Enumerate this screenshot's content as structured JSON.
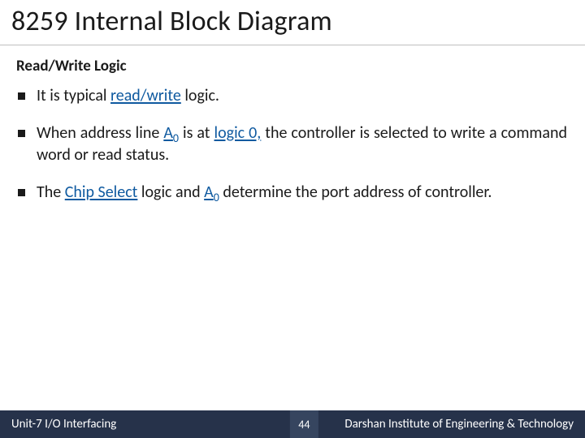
{
  "title": "8259 Internal Block Diagram",
  "subtitle": "Read/Write Logic",
  "bullets": [
    {
      "pre": "It is typical ",
      "link": "read/write",
      "post": " logic."
    },
    {
      "pre": "When address line ",
      "link": "A",
      "linksub": "0",
      "mid": " is at ",
      "link2": "logic 0,",
      "post2": " the controller is selected to write a command word or read status."
    },
    {
      "pre": "The ",
      "link": "Chip Select",
      "mid": " logic and ",
      "link2": "A",
      "link2sub": "0",
      "post2": " determine the port address of controller."
    }
  ],
  "footer": {
    "unit": "Unit-7 I/O Interfacing",
    "page": "44",
    "org": "Darshan Institute of Engineering & Technology"
  }
}
